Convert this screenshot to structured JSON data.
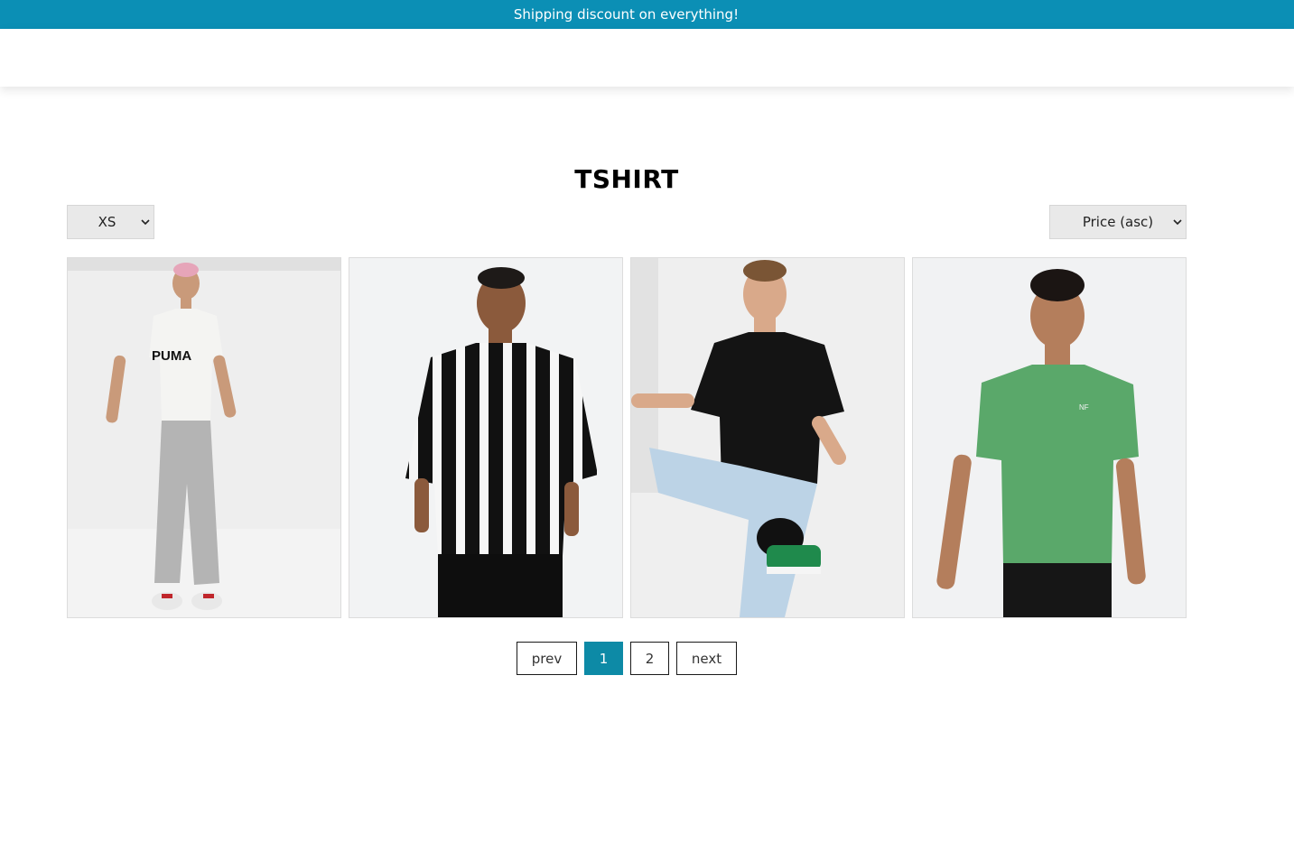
{
  "announcement": {
    "text": "Shipping discount on everything!"
  },
  "colors": {
    "accent": "#0b8fb5",
    "active_page": "#0d8aa6"
  },
  "category": {
    "title": "TSHIRT"
  },
  "filters": {
    "size": {
      "selected": "XS"
    },
    "sort": {
      "selected": "Price (asc)"
    }
  },
  "products": [
    {
      "image": "white-puma-tshirt-grey-joggers",
      "shirt_color": "#f4f4f2"
    },
    {
      "image": "black-white-vertical-stripe-tshirt",
      "shirt_color": "#111111"
    },
    {
      "image": "black-tshirt-light-blue-jeans",
      "shirt_color": "#141414"
    },
    {
      "image": "green-the-north-face-tshirt",
      "shirt_color": "#5aa86a"
    }
  ],
  "pagination": {
    "prev_label": "prev",
    "pages": [
      "1",
      "2"
    ],
    "current": "1",
    "next_label": "next"
  }
}
